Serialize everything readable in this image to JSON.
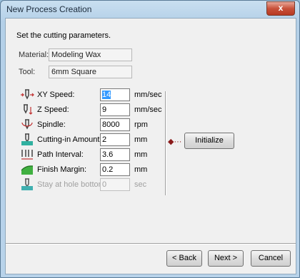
{
  "window": {
    "title": "New Process Creation",
    "close_glyph": "x"
  },
  "heading": "Set the cutting parameters.",
  "info": {
    "material_label": "Material:",
    "material_value": "Modeling Wax",
    "tool_label": "Tool:",
    "tool_value": "6mm Square"
  },
  "params": [
    {
      "label": "XY Speed:",
      "value": "14",
      "unit": "mm/sec",
      "icon": "xy-speed-icon"
    },
    {
      "label": "Z Speed:",
      "value": "9",
      "unit": "mm/sec",
      "icon": "z-speed-icon"
    },
    {
      "label": "Spindle:",
      "value": "8000",
      "unit": "rpm",
      "icon": "spindle-icon"
    },
    {
      "label": "Cutting-in Amount:",
      "value": "2",
      "unit": "mm",
      "icon": "cutting-in-icon"
    },
    {
      "label": "Path Interval:",
      "value": "3.6",
      "unit": "mm",
      "icon": "path-interval-icon"
    },
    {
      "label": "Finish Margin:",
      "value": "0.2",
      "unit": "mm",
      "icon": "finish-margin-icon"
    },
    {
      "label": "Stay at hole bottom:",
      "value": "0",
      "unit": "sec",
      "icon": "stay-hole-bottom-icon"
    }
  ],
  "initialize": {
    "arrow": "◆···",
    "label": "Initialize"
  },
  "buttons": {
    "back": "< Back",
    "next": "Next >",
    "cancel": "Cancel"
  }
}
